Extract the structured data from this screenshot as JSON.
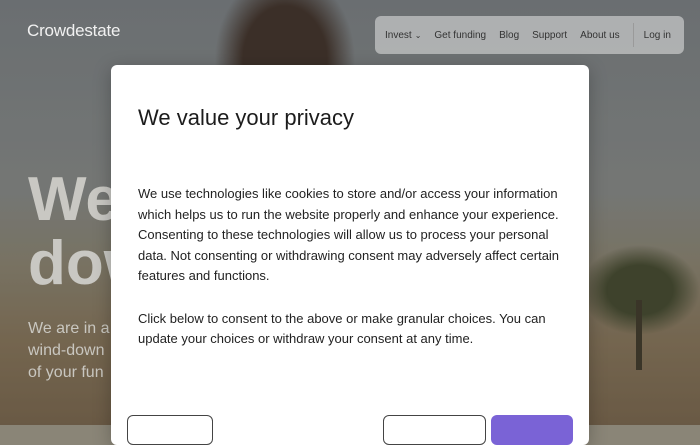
{
  "brand": {
    "logo_text": "Crowdestate"
  },
  "nav": {
    "items": [
      "Invest",
      "Get funding",
      "Blog",
      "Support",
      "About us"
    ],
    "login": "Log in"
  },
  "hero": {
    "title_line1": "We",
    "title_line2": "dow",
    "sub_line1": "We are in a",
    "sub_line2": "wind-down",
    "sub_line3": "of your fun"
  },
  "modal": {
    "title": "We value your privacy",
    "paragraph1": "We use technologies like cookies to store and/or access your information which helps us to run the website properly and enhance your experience. Consenting to these technologies will allow us to process your personal data. Not consenting or withdrawing consent may adversely affect certain features and functions.",
    "paragraph2": "Click below to consent to the above or make granular choices. You can update your choices or withdraw your consent at any time."
  },
  "colors": {
    "accent": "#7a63d6"
  }
}
